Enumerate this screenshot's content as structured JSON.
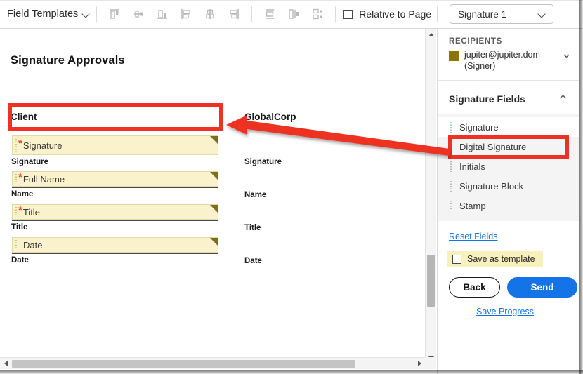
{
  "toolbar": {
    "field_templates_label": "Field Templates",
    "align_buttons": [
      {
        "name": "align-top",
        "title": "Align Top"
      },
      {
        "name": "align-middle-horizontal",
        "title": "Align Middle"
      },
      {
        "name": "align-bottom",
        "title": "Align Bottom"
      },
      {
        "name": "align-left",
        "title": "Align Left"
      },
      {
        "name": "align-center-vertical",
        "title": "Align Center"
      },
      {
        "name": "align-right",
        "title": "Align Right"
      },
      {
        "name": "distribute-vertical",
        "title": "Distribute Vertically"
      },
      {
        "name": "match-width",
        "title": "Match Width"
      },
      {
        "name": "match-size",
        "title": "Match Size"
      }
    ],
    "relative_to_page_label": "Relative to Page",
    "relative_to_page_checked": false,
    "selected_field": "Signature 1",
    "dropdown_icon": "chevron-down-icon"
  },
  "document": {
    "title": "Signature Approvals",
    "columns": [
      {
        "heading": "Client"
      },
      {
        "heading": "GlobalCorp"
      }
    ],
    "client_fields": [
      {
        "name": "Signature",
        "label": "Signature",
        "required": true,
        "highlighted": true
      },
      {
        "name": "Full Name",
        "label": "Name",
        "required": true,
        "highlighted": false
      },
      {
        "name": "Title",
        "label": "Title",
        "required": true,
        "highlighted": false
      },
      {
        "name": "Date",
        "label": "Date",
        "required": false,
        "highlighted": false
      }
    ],
    "corp_fields": [
      {
        "label": "Signature"
      },
      {
        "label": "Name"
      },
      {
        "label": "Title"
      },
      {
        "label": "Date"
      }
    ]
  },
  "sidebar": {
    "recipients_title": "RECIPIENTS",
    "recipient_email": "jupiter@jupiter.dom",
    "recipient_role": "(Signer)",
    "recipient_color": "#8a7508",
    "recipient_expand_icon": "chevron-down-icon",
    "signature_fields_title": "Signature Fields",
    "signature_fields_collapse_icon": "chevron-up-icon",
    "signature_fields": [
      {
        "label": "Signature",
        "selected": true
      },
      {
        "label": "Digital Signature",
        "selected": false
      },
      {
        "label": "Initials",
        "selected": false
      },
      {
        "label": "Signature Block",
        "selected": false
      },
      {
        "label": "Stamp",
        "selected": false
      }
    ],
    "reset_fields_label": "Reset Fields",
    "save_as_template_label": "Save as template",
    "save_as_template_checked": false,
    "back_label": "Back",
    "send_label": "Send",
    "save_progress_label": "Save Progress"
  },
  "colors": {
    "accent_blue": "#1473E6",
    "annotation_red": "#EE3124",
    "field_fill": "#FAF2CD",
    "field_corner": "#7D6F1C",
    "required_star": "#E8481C",
    "highlight_yellow": "#F8F1BD"
  },
  "scrollbars": {
    "vertical_position_percent": 70,
    "horizontal_position_percent": 0
  }
}
